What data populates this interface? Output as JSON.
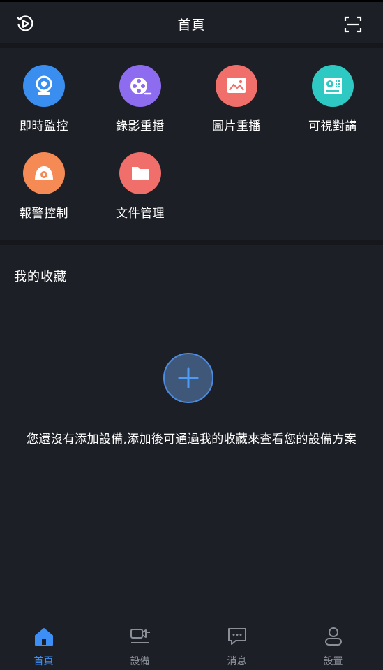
{
  "header": {
    "title": "首頁",
    "left_icon": "playback-history-icon",
    "right_icon": "scan-icon"
  },
  "features": [
    {
      "label": "即時監控",
      "icon": "camera-icon",
      "color": "#3a8ef0"
    },
    {
      "label": "錄影重播",
      "icon": "film-reel-icon",
      "color": "#8e6cf0"
    },
    {
      "label": "圖片重播",
      "icon": "image-icon",
      "color": "#f06f6b"
    },
    {
      "label": "可視對講",
      "icon": "intercom-icon",
      "color": "#2fc9c3"
    },
    {
      "label": "報警控制",
      "icon": "alarm-icon",
      "color": "#f58a55"
    },
    {
      "label": "文件管理",
      "icon": "folder-icon",
      "color": "#f06f6b"
    }
  ],
  "favorites": {
    "title": "我的收藏",
    "empty_message": "您還沒有添加設備,添加後可通過我的收藏來查看您的設備方案",
    "add_icon": "plus-icon"
  },
  "nav": {
    "active_color": "#3d8ff5",
    "inactive_color": "#8b8f98",
    "items": [
      {
        "label": "首頁",
        "icon": "home-icon",
        "active": true
      },
      {
        "label": "設備",
        "icon": "device-icon",
        "active": false
      },
      {
        "label": "消息",
        "icon": "message-icon",
        "active": false
      },
      {
        "label": "設置",
        "icon": "user-icon",
        "active": false
      }
    ]
  }
}
